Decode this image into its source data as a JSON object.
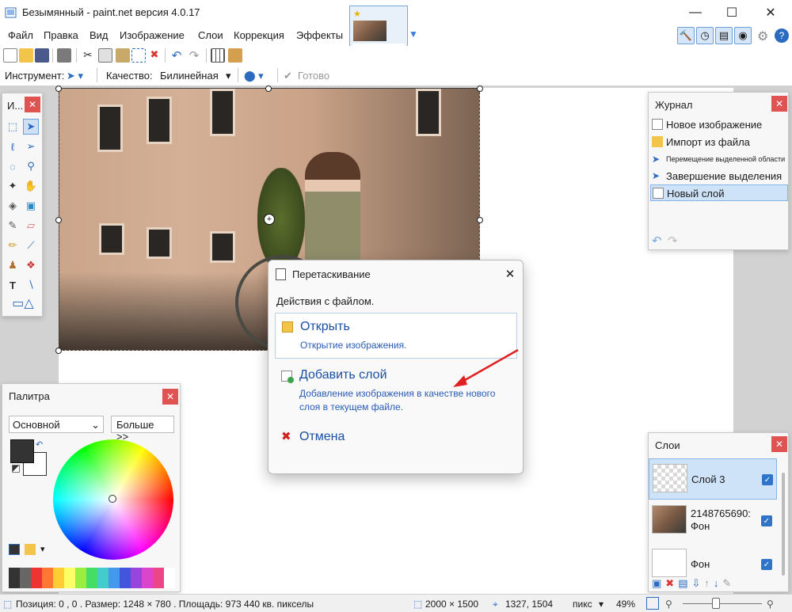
{
  "window": {
    "title": "Безымянный - paint.net версия 4.0.17",
    "minimize": "—",
    "maximize": "☐",
    "close": "✕"
  },
  "menu": [
    "Файл",
    "Правка",
    "Вид",
    "Изображение",
    "Слои",
    "Коррекция",
    "Эффекты"
  ],
  "toolbar2": {
    "tool_label": "Инструмент:",
    "quality_label": "Качество:",
    "quality_value": "Билинейная",
    "done_label": "Готово"
  },
  "tools_panel": {
    "title": "И..."
  },
  "history_panel": {
    "title": "Журнал",
    "items": [
      "Новое изображение",
      "Импорт из файла",
      "Перемещение выделенной области",
      "Завершение выделения",
      "Новый слой"
    ]
  },
  "palette_panel": {
    "title": "Палитра",
    "palette_select": "Основной",
    "more_button": "Больше >>"
  },
  "layers_panel": {
    "title": "Слои",
    "layers": [
      {
        "name": "Слой 3",
        "checked": true,
        "selected": true
      },
      {
        "name": "2148765690: Фон",
        "checked": true,
        "selected": false
      },
      {
        "name": "Фон",
        "checked": true,
        "selected": false
      }
    ]
  },
  "dialog": {
    "title": "Перетаскивание",
    "subtitle": "Действия с файлом.",
    "open": {
      "label": "Открыть",
      "desc": "Открытие изображения."
    },
    "add_layer": {
      "label": "Добавить слой",
      "desc": "Добавление изображения в качестве нового слоя в текущем файле."
    },
    "cancel": {
      "label": "Отмена"
    }
  },
  "statusbar": {
    "position": "Позиция: 0 , 0 . Размер: 1248 × 780 . Площадь: 973 440 кв. пикселы",
    "image_size": "2000 × 1500",
    "cursor": "1327, 1504",
    "units": "пикс",
    "zoom": "49%"
  },
  "colors": {
    "accent": "#1a4fa3",
    "close_red": "#e05353",
    "annotation_arrow": "#e02020"
  }
}
